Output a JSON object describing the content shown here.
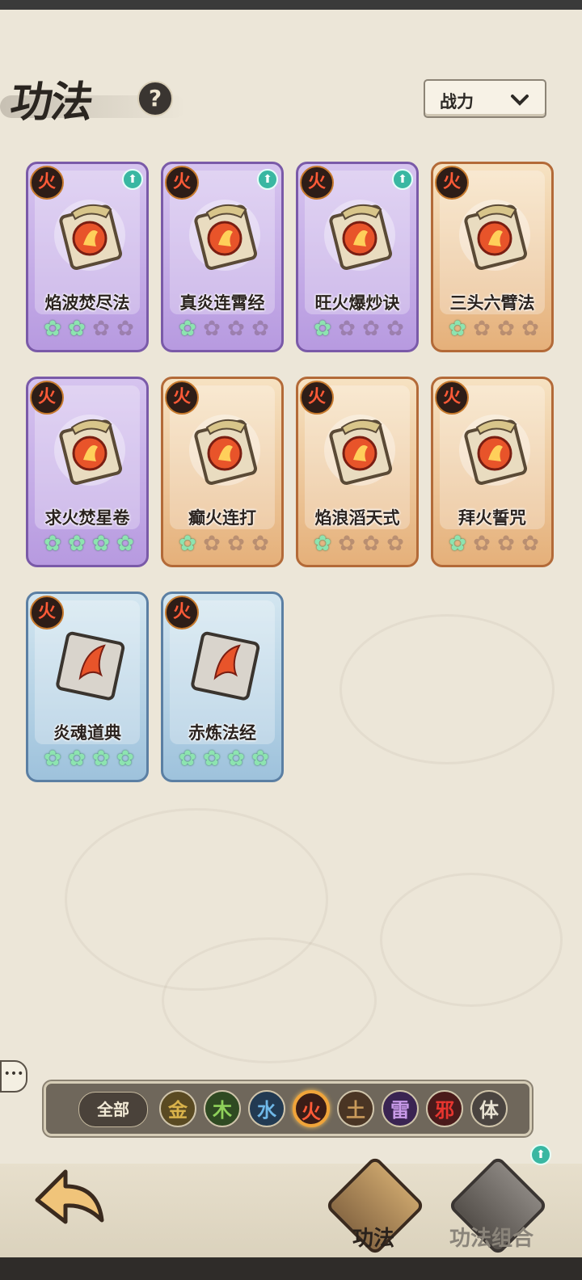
{
  "header": {
    "title": "功法",
    "help_icon": "?",
    "sort_dropdown": {
      "selected": "战力",
      "chevron": "⌄"
    }
  },
  "cards": [
    {
      "name": "焰波焚尽法",
      "rarity": "purple",
      "element_badge": "火",
      "upgrade_available": true,
      "stars_filled": 2,
      "stars_total": 4
    },
    {
      "name": "真炎连霄经",
      "rarity": "purple",
      "element_badge": "火",
      "upgrade_available": true,
      "stars_filled": 1,
      "stars_total": 4
    },
    {
      "name": "旺火爆炒诀",
      "rarity": "purple",
      "element_badge": "火",
      "upgrade_available": true,
      "stars_filled": 1,
      "stars_total": 4
    },
    {
      "name": "三头六臂法",
      "rarity": "orange",
      "element_badge": "火",
      "upgrade_available": false,
      "stars_filled": 1,
      "stars_total": 4
    },
    {
      "name": "求火焚星卷",
      "rarity": "purple",
      "element_badge": "火",
      "upgrade_available": false,
      "stars_filled": 4,
      "stars_total": 4
    },
    {
      "name": "癫火连打",
      "rarity": "orange",
      "element_badge": "火",
      "upgrade_available": false,
      "stars_filled": 1,
      "stars_total": 4
    },
    {
      "name": "焰浪滔天式",
      "rarity": "orange",
      "element_badge": "火",
      "upgrade_available": false,
      "stars_filled": 1,
      "stars_total": 4
    },
    {
      "name": "拜火誓咒",
      "rarity": "orange",
      "element_badge": "火",
      "upgrade_available": false,
      "stars_filled": 1,
      "stars_total": 4
    },
    {
      "name": "炎魂道典",
      "rarity": "blue",
      "element_badge": "火",
      "upgrade_available": false,
      "stars_filled": 4,
      "stars_total": 4
    },
    {
      "name": "赤炼法经",
      "rarity": "blue",
      "element_badge": "火",
      "upgrade_available": false,
      "stars_filled": 4,
      "stars_total": 4
    }
  ],
  "filter": {
    "all_label": "全部",
    "elements": [
      {
        "label": "金",
        "color": "#d9b24a",
        "bg": "#5a4a22"
      },
      {
        "label": "木",
        "color": "#8fd15a",
        "bg": "#2f4a22"
      },
      {
        "label": "水",
        "color": "#6fb8e8",
        "bg": "#223a52"
      },
      {
        "label": "火",
        "color": "#ff5a37",
        "bg": "#3a1d17",
        "selected": true
      },
      {
        "label": "土",
        "color": "#c99a5a",
        "bg": "#4a3524"
      },
      {
        "label": "雷",
        "color": "#c89ae8",
        "bg": "#3a2452"
      },
      {
        "label": "邪",
        "color": "#e8352f",
        "bg": "#4a1a1a"
      },
      {
        "label": "体",
        "color": "#e8e2d2",
        "bg": "#4a4440"
      }
    ]
  },
  "bottom_nav": {
    "tabs": [
      {
        "label": "功法",
        "active": true
      },
      {
        "label": "功法组合",
        "active": false,
        "upgrade_available": true
      }
    ]
  },
  "colors": {
    "accent_fire": "#ff5a37",
    "upgrade": "#39b7a2",
    "star_on": "#8de4b0"
  }
}
